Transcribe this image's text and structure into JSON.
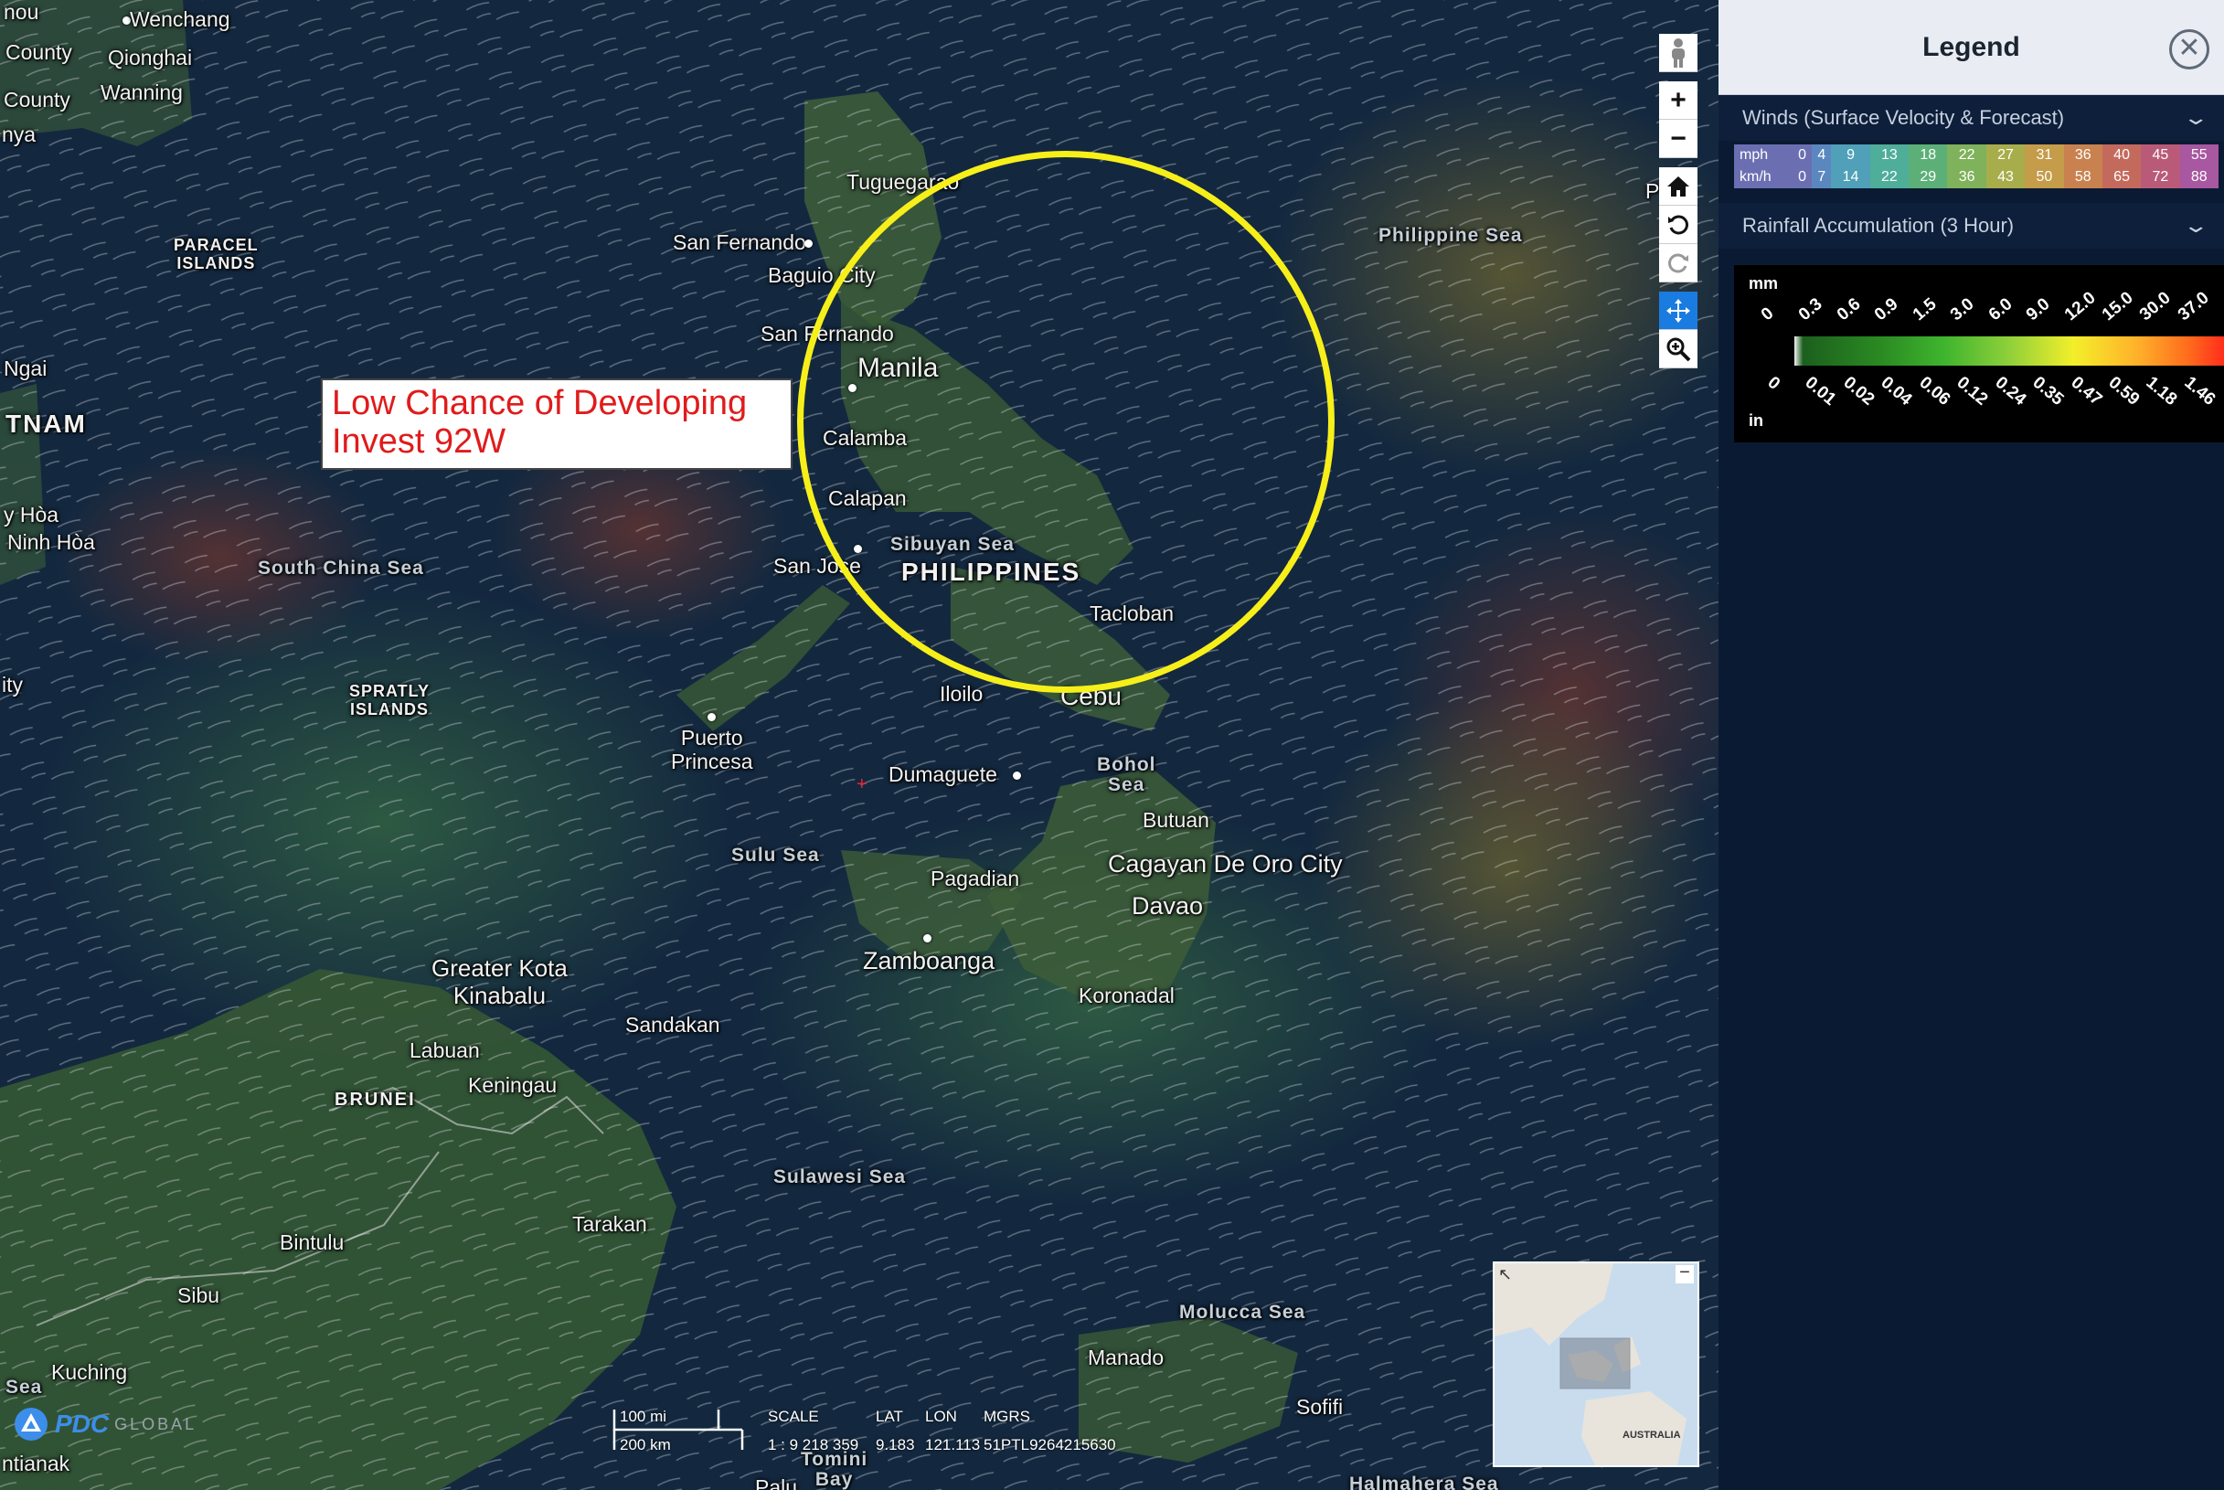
{
  "map": {
    "annotation": {
      "line1": "Low Chance of Developing",
      "line2": "Invest 92W"
    },
    "places": {
      "wenchang": "Wenchang",
      "county1": "County",
      "county2": "County",
      "qionghai": "Qionghai",
      "wanning": "Wanning",
      "nya": "nya",
      "nou": "nou",
      "paracel": "PARACEL\nISLANDS",
      "ngai": "Ngai",
      "vietnam": "TNAM",
      "y_hoa": "y Hòa",
      "ninh_hoa": "Ninh Hòa",
      "ity": "ity",
      "south_china_sea": "South China Sea",
      "spratly": "SPRATLY\nISLANDS",
      "tuguegarao": "Tuguegarao",
      "san_fernando1": "San Fernando",
      "baguio": "Baguio City",
      "san_fernando2": "San Fernando",
      "manila": "Manila",
      "calamba": "Calamba",
      "calapan": "Calapan",
      "sibuyan_sea": "Sibuyan Sea",
      "san_jose": "San Jose",
      "philippines": "PHILIPPINES",
      "tacloban": "Tacloban",
      "philippine_sea": "Philippine Sea",
      "iloilo": "Iloilo",
      "cebu": "Cebu",
      "puerto_princesa": "Puerto\nPrincesa",
      "dumaguete": "Dumaguete",
      "bohol_sea": "Bohol\nSea",
      "butuan": "Butuan",
      "sulu_sea": "Sulu Sea",
      "pagadian": "Pagadian",
      "cagayan": "Cagayan De Oro City",
      "davao": "Davao",
      "zamboanga": "Zamboanga",
      "koronadal": "Koronadal",
      "kota_kinabalu": "Greater Kota\nKinabalu",
      "sandakan": "Sandakan",
      "labuan": "Labuan",
      "keningau": "Keningau",
      "brunei": "BRUNEI",
      "sulawesi_sea": "Sulawesi Sea",
      "tarakan": "Tarakan",
      "bintulu": "Bintulu",
      "sibu": "Sibu",
      "kuching": "Kuching",
      "sea_left": "Sea",
      "ntianak": "ntianak",
      "molucca_sea": "Molucca Sea",
      "manado": "Manado",
      "sofifi": "Sofifi",
      "tomini_bay": "Tomini\nBay",
      "halmahera_sea": "Halmahera Sea",
      "palu": "Palu",
      "pp": "P p"
    },
    "scale": {
      "mi": "100 mi",
      "km": "200 km"
    },
    "coords": {
      "scale_label": "SCALE",
      "scale_value": "1 : 9 218 359",
      "lat_label": "LAT",
      "lat_value": "9.183",
      "lon_label": "LON",
      "lon_value": "121.113",
      "mgrs_label": "MGRS",
      "mgrs_value": "51PTL9264215630"
    },
    "logo": {
      "name": "PDC",
      "suffix": "GLOBAL"
    },
    "overview": {
      "label": "AUSTRALIA",
      "collapse": "−",
      "expand": "↖"
    },
    "tools": {
      "person": "person-icon",
      "zoom_in": "+",
      "zoom_out": "−",
      "home": "home-icon",
      "rotate_left": "rotate-left-icon",
      "rotate_right": "rotate-right-icon",
      "pan": "pan-icon",
      "zoom_box": "zoom-box-icon"
    }
  },
  "legend": {
    "title": "Legend",
    "close_icon": "close-icon",
    "winds": {
      "title": "Winds (Surface Velocity & Forecast)",
      "mph_label": "mph",
      "kmh_label": "km/h",
      "mph": [
        "0",
        "4",
        "9",
        "13",
        "18",
        "22",
        "27",
        "31",
        "36",
        "40",
        "45",
        "55"
      ],
      "kmh": [
        "0",
        "7",
        "14",
        "22",
        "29",
        "36",
        "43",
        "50",
        "58",
        "65",
        "72",
        "88"
      ],
      "colors": [
        "#6b6fb2",
        "#5b87bf",
        "#4fa0b8",
        "#4fae9a",
        "#5cb077",
        "#7fb25a",
        "#a8ad4c",
        "#c49c4a",
        "#c9824f",
        "#c46a5d",
        "#b95b78",
        "#a857a1"
      ]
    },
    "rainfall": {
      "title": "Rainfall Accumulation (3 Hour)",
      "mm_label": "mm",
      "in_label": "in",
      "mm": [
        "0",
        "0.3",
        "0.6",
        "0.9",
        "1.5",
        "3.0",
        "6.0",
        "9.0",
        "12.0",
        "15.0",
        "30.0",
        "37.0"
      ],
      "in": [
        "0",
        "0.01",
        "0.02",
        "0.04",
        "0.06",
        "0.12",
        "0.24",
        "0.35",
        "0.47",
        "0.59",
        "1.18",
        "1.46"
      ]
    }
  }
}
